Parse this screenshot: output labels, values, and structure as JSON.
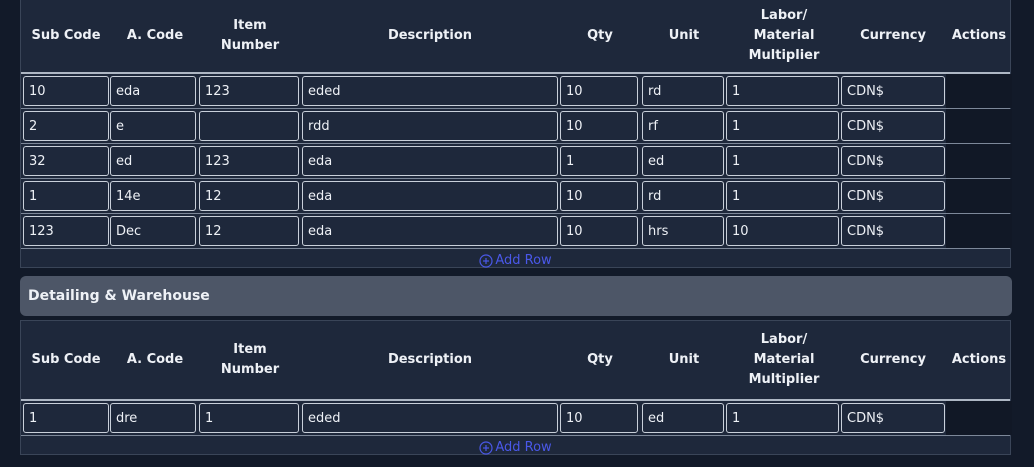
{
  "columns": [
    "Sub Code",
    "A. Code",
    "Item\nNumber",
    "Description",
    "Qty",
    "Unit",
    "Labor/\nMaterial\nMultiplier",
    "Currency",
    "Actions"
  ],
  "add_row_label": "Add Row",
  "sections": [
    {
      "title": "",
      "rows": [
        [
          "10",
          "eda",
          "123",
          "eded",
          "10",
          "rd",
          "1",
          "CDN$"
        ],
        [
          "2",
          "e",
          "",
          "rdd",
          "10",
          "rf",
          "1",
          "CDN$"
        ],
        [
          "32",
          "ed",
          "123",
          "eda",
          "1",
          "ed",
          "1",
          "CDN$"
        ],
        [
          "1",
          "14e",
          "12",
          "eda",
          "10",
          "rd",
          "1",
          "CDN$"
        ],
        [
          "123",
          "Dec",
          "12",
          "eda",
          "10",
          "hrs",
          "10",
          "CDN$"
        ]
      ]
    },
    {
      "title": "Detailing & Warehouse",
      "rows": [
        [
          "1",
          "dre",
          "1",
          "eded",
          "10",
          "ed",
          "1",
          "CDN$"
        ]
      ]
    }
  ],
  "colors": {
    "page_bg": "#121a29",
    "panel_bg": "#1e283b",
    "section_header_bg": "#4d5667",
    "add_row_link": "#4a58e8",
    "cell_border": "#c9d0da"
  }
}
